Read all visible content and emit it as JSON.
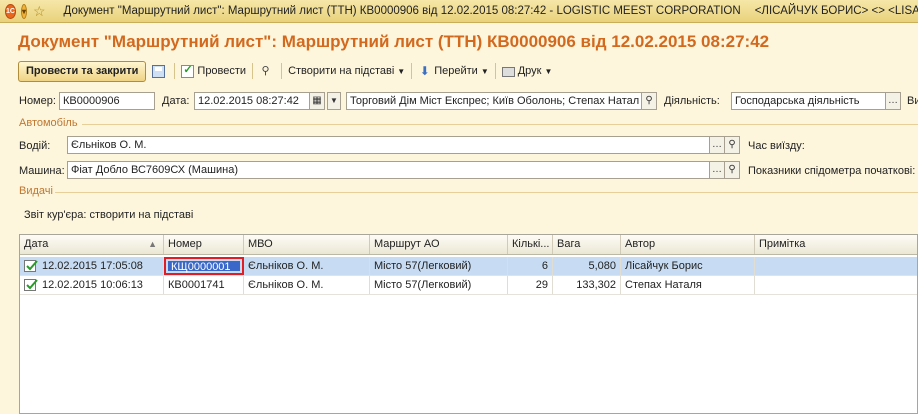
{
  "window": {
    "title": "Документ \"Маршрутний лист\": Маршрутний лист (ТТН) КВ0000906 від 12.02.2015 08:27:42 - LOGISTIC MEEST CORPORATION",
    "user": "<ЛІСАЙЧУК БОРИС>  <>  <LISAYCHU",
    "logo": "1С"
  },
  "heading": "Документ \"Маршрутний лист\": Маршрутний лист (ТТН) КВ0000906 від 12.02.2015 08:27:42",
  "toolbar": {
    "post_close": "Провести та закрити",
    "post": "Провести",
    "create_based": "Створити на підставі",
    "goto": "Перейти",
    "print": "Друк"
  },
  "header": {
    "number_label": "Номер:",
    "number_value": "КВ0000906",
    "date_label": "Дата:",
    "date_value": "12.02.2015 08:27:42",
    "org_value": "Торговий Дім Міст Експрес; Київ Оболонь; Степах Натал",
    "activity_label": "Діяльність:",
    "activity_value": "Господарська діяльність",
    "cut_label": "Ви"
  },
  "auto": {
    "group_label": "Автомобіль",
    "driver_label": "Водій:",
    "driver_value": "Єльніков О. М.",
    "departure_label": "Час виїзду:",
    "car_label": "Машина:",
    "car_value": "Фіат Добло ВС7609СХ (Машина)",
    "odometer_label": "Показники спідометра початкові:"
  },
  "issues": {
    "group_label": "Видачі",
    "courier_report": "Звіт кур'єра: створити на підставі"
  },
  "grid": {
    "columns": [
      "Дата",
      "Номер",
      "МВО",
      "Маршрут АО",
      "Кількі...",
      "Вага",
      "Автор",
      "Примітка"
    ],
    "rows": [
      {
        "date": "12.02.2015 17:05:08",
        "number": "КЩ0000001",
        "mvo": "Єльніков О. М.",
        "route": "Місто 57(Легковий)",
        "qty": "6",
        "weight": "5,080",
        "author": "Лісайчук Борис",
        "note": ""
      },
      {
        "date": "12.02.2015 10:06:13",
        "number": "КВ0001741",
        "mvo": "Єльніков О. М.",
        "route": "Місто 57(Легковий)",
        "qty": "29",
        "weight": "133,302",
        "author": "Степах Наталя",
        "note": ""
      }
    ]
  },
  "colors": {
    "heading": "#d2691e",
    "selection": "#c7dcf3",
    "highlight_border": "#e01d24"
  }
}
